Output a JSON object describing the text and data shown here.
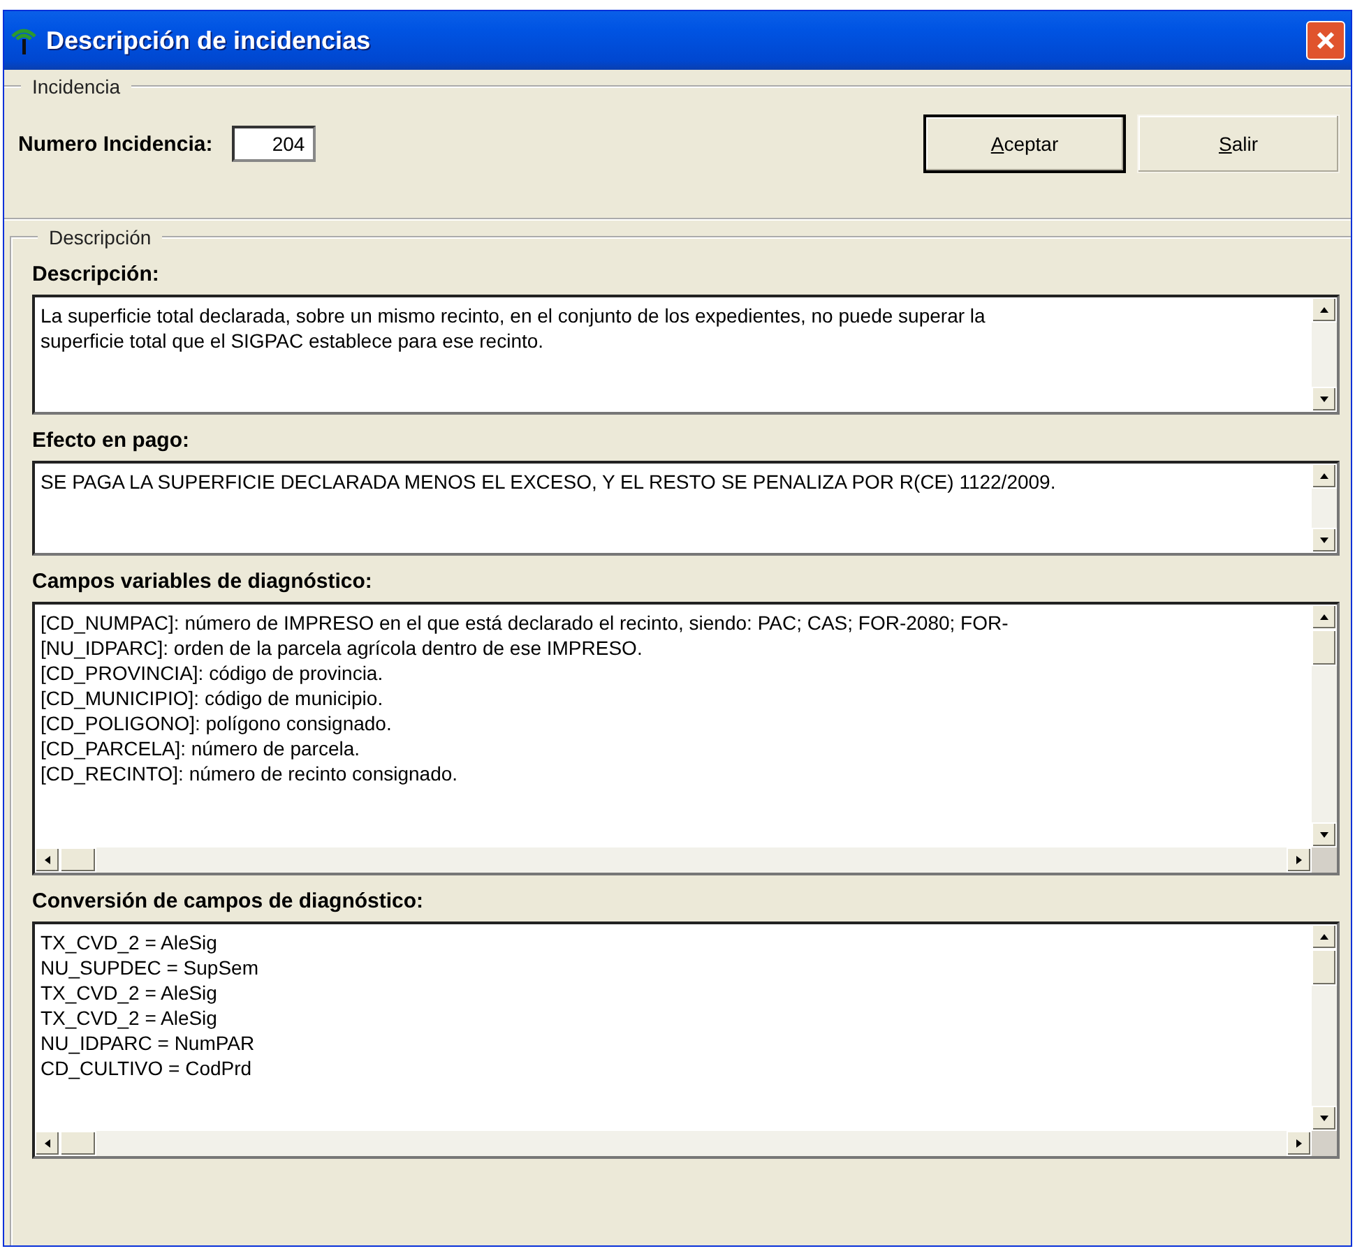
{
  "window": {
    "title": "Descripción de incidencias"
  },
  "incidencia": {
    "legend": "Incidencia",
    "number_label": "Numero Incidencia:",
    "number_value": "204",
    "buttons": [
      {
        "label": "Aceptar",
        "default": true
      },
      {
        "label": "Salir",
        "default": false
      }
    ]
  },
  "descripcion": {
    "legend": "Descripción",
    "fields": [
      {
        "kind": "memo",
        "label": "Descripción:",
        "lines": [
          "La superficie total declarada, sobre un mismo recinto, en el conjunto de los expedientes, no puede superar la",
          "superficie total que el SIGPAC establece para ese recinto."
        ]
      },
      {
        "kind": "memo",
        "label": "Efecto en pago:",
        "lines": [
          "SE PAGA LA SUPERFICIE DECLARADA MENOS EL EXCESO, Y EL RESTO SE PENALIZA POR R(CE) 1122/2009."
        ]
      },
      {
        "kind": "scroll_memo",
        "label": "Campos variables de diagnóstico:",
        "lines": [
          "[CD_NUMPAC]: número de IMPRESO en el que está declarado el recinto, siendo: PAC; CAS; FOR-2080; FOR-",
          "[NU_IDPARC]: orden de la parcela agrícola dentro de ese IMPRESO.",
          "[CD_PROVINCIA]: código de provincia.",
          "[CD_MUNICIPIO]: código de municipio.",
          "[CD_POLIGONO]: polígono consignado.",
          "[CD_PARCELA]: número de parcela.",
          "[CD_RECINTO]: número de recinto consignado."
        ]
      },
      {
        "kind": "scroll_memo",
        "label": "Conversión de campos de diagnóstico:",
        "lines": [
          "TX_CVD_2 = AleSig",
          "NU_SUPDEC = SupSem",
          "TX_CVD_2 = AleSig",
          "TX_CVD_2 = AleSig",
          "NU_IDPARC = NumPAR",
          "CD_CULTIVO = CodPrd"
        ]
      }
    ]
  }
}
